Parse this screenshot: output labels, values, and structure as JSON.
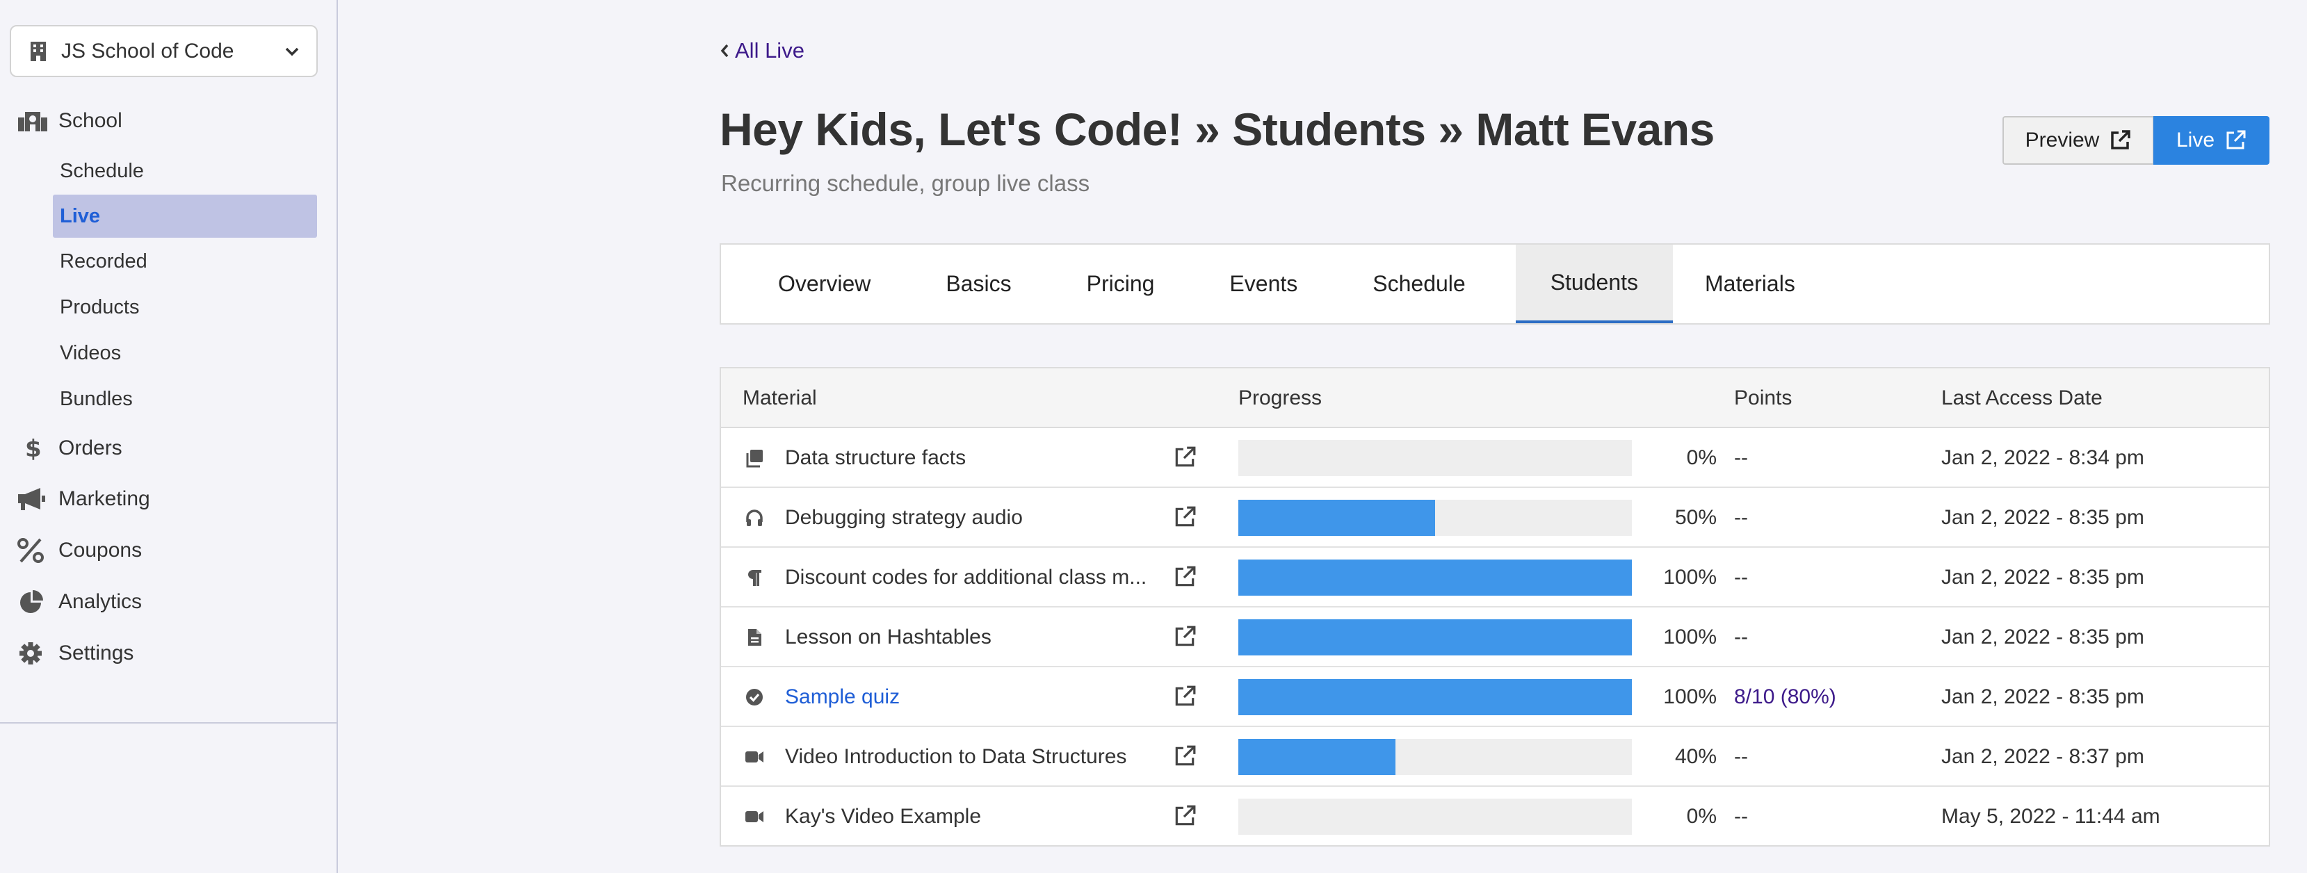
{
  "sidebar": {
    "school_name": "JS School of Code",
    "school_label": "School",
    "sub_items": [
      "Schedule",
      "Live",
      "Recorded",
      "Products",
      "Videos",
      "Bundles"
    ],
    "active_sub": "Live",
    "orders": "Orders",
    "marketing": "Marketing",
    "coupons": "Coupons",
    "analytics": "Analytics",
    "settings": "Settings"
  },
  "main": {
    "back_link": "All Live",
    "title": "Hey Kids, Let's Code! » Students » Matt Evans",
    "subtitle": "Recurring schedule, group live class",
    "preview_button": "Preview",
    "live_button": "Live",
    "tabs": [
      "Overview",
      "Basics",
      "Pricing",
      "Events",
      "Schedule",
      "Students",
      "Materials"
    ],
    "active_tab": "Students"
  },
  "table": {
    "headers": {
      "material": "Material",
      "progress": "Progress",
      "points": "Points",
      "last_access": "Last Access Date"
    },
    "rows": [
      {
        "icon": "copy-icon",
        "name": "Data structure facts",
        "progress": 0,
        "progress_label": "0%",
        "points": "--",
        "date": "Jan 2, 2022 - 8:34 pm"
      },
      {
        "icon": "headphones-icon",
        "name": "Debugging strategy audio",
        "progress": 50,
        "progress_label": "50%",
        "points": "--",
        "date": "Jan 2, 2022 - 8:35 pm"
      },
      {
        "icon": "paragraph-icon",
        "name": "Discount codes for additional class m...",
        "progress": 100,
        "progress_label": "100%",
        "points": "--",
        "date": "Jan 2, 2022 - 8:35 pm"
      },
      {
        "icon": "document-icon",
        "name": "Lesson on Hashtables",
        "progress": 100,
        "progress_label": "100%",
        "points": "--",
        "date": "Jan 2, 2022 - 8:35 pm"
      },
      {
        "icon": "check-circle-icon",
        "name": "Sample quiz",
        "progress": 100,
        "progress_label": "100%",
        "points": "8/10 (80%)",
        "date": "Jan 2, 2022 - 8:35 pm"
      },
      {
        "icon": "video-icon",
        "name": "Video Introduction to Data Structures",
        "progress": 40,
        "progress_label": "40%",
        "points": "--",
        "date": "Jan 2, 2022 - 8:37 pm"
      },
      {
        "icon": "video-icon",
        "name": "Kay's Video Example",
        "progress": 0,
        "progress_label": "0%",
        "points": "--",
        "date": "May 5, 2022 - 11:44 am"
      }
    ]
  },
  "colors": {
    "accent_blue": "#2b83e0",
    "progress_fill": "#3f96ea",
    "active_nav_bg": "#bfc3e4",
    "link_purple": "#3d1a8a"
  }
}
